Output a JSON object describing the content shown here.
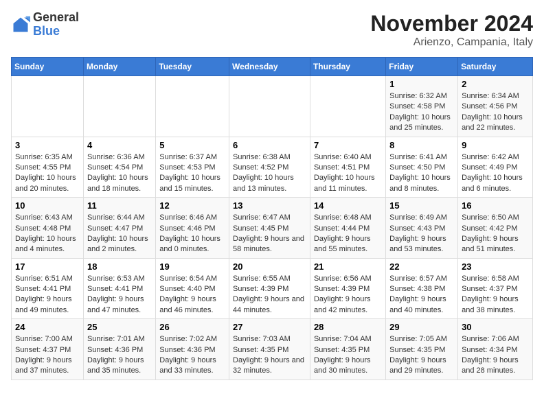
{
  "header": {
    "logo_general": "General",
    "logo_blue": "Blue",
    "month_title": "November 2024",
    "location": "Arienzo, Campania, Italy"
  },
  "days_of_week": [
    "Sunday",
    "Monday",
    "Tuesday",
    "Wednesday",
    "Thursday",
    "Friday",
    "Saturday"
  ],
  "weeks": [
    {
      "days": [
        {
          "number": "",
          "info": ""
        },
        {
          "number": "",
          "info": ""
        },
        {
          "number": "",
          "info": ""
        },
        {
          "number": "",
          "info": ""
        },
        {
          "number": "",
          "info": ""
        },
        {
          "number": "1",
          "info": "Sunrise: 6:32 AM\nSunset: 4:58 PM\nDaylight: 10 hours and 25 minutes."
        },
        {
          "number": "2",
          "info": "Sunrise: 6:34 AM\nSunset: 4:56 PM\nDaylight: 10 hours and 22 minutes."
        }
      ]
    },
    {
      "days": [
        {
          "number": "3",
          "info": "Sunrise: 6:35 AM\nSunset: 4:55 PM\nDaylight: 10 hours and 20 minutes."
        },
        {
          "number": "4",
          "info": "Sunrise: 6:36 AM\nSunset: 4:54 PM\nDaylight: 10 hours and 18 minutes."
        },
        {
          "number": "5",
          "info": "Sunrise: 6:37 AM\nSunset: 4:53 PM\nDaylight: 10 hours and 15 minutes."
        },
        {
          "number": "6",
          "info": "Sunrise: 6:38 AM\nSunset: 4:52 PM\nDaylight: 10 hours and 13 minutes."
        },
        {
          "number": "7",
          "info": "Sunrise: 6:40 AM\nSunset: 4:51 PM\nDaylight: 10 hours and 11 minutes."
        },
        {
          "number": "8",
          "info": "Sunrise: 6:41 AM\nSunset: 4:50 PM\nDaylight: 10 hours and 8 minutes."
        },
        {
          "number": "9",
          "info": "Sunrise: 6:42 AM\nSunset: 4:49 PM\nDaylight: 10 hours and 6 minutes."
        }
      ]
    },
    {
      "days": [
        {
          "number": "10",
          "info": "Sunrise: 6:43 AM\nSunset: 4:48 PM\nDaylight: 10 hours and 4 minutes."
        },
        {
          "number": "11",
          "info": "Sunrise: 6:44 AM\nSunset: 4:47 PM\nDaylight: 10 hours and 2 minutes."
        },
        {
          "number": "12",
          "info": "Sunrise: 6:46 AM\nSunset: 4:46 PM\nDaylight: 10 hours and 0 minutes."
        },
        {
          "number": "13",
          "info": "Sunrise: 6:47 AM\nSunset: 4:45 PM\nDaylight: 9 hours and 58 minutes."
        },
        {
          "number": "14",
          "info": "Sunrise: 6:48 AM\nSunset: 4:44 PM\nDaylight: 9 hours and 55 minutes."
        },
        {
          "number": "15",
          "info": "Sunrise: 6:49 AM\nSunset: 4:43 PM\nDaylight: 9 hours and 53 minutes."
        },
        {
          "number": "16",
          "info": "Sunrise: 6:50 AM\nSunset: 4:42 PM\nDaylight: 9 hours and 51 minutes."
        }
      ]
    },
    {
      "days": [
        {
          "number": "17",
          "info": "Sunrise: 6:51 AM\nSunset: 4:41 PM\nDaylight: 9 hours and 49 minutes."
        },
        {
          "number": "18",
          "info": "Sunrise: 6:53 AM\nSunset: 4:41 PM\nDaylight: 9 hours and 47 minutes."
        },
        {
          "number": "19",
          "info": "Sunrise: 6:54 AM\nSunset: 4:40 PM\nDaylight: 9 hours and 46 minutes."
        },
        {
          "number": "20",
          "info": "Sunrise: 6:55 AM\nSunset: 4:39 PM\nDaylight: 9 hours and 44 minutes."
        },
        {
          "number": "21",
          "info": "Sunrise: 6:56 AM\nSunset: 4:39 PM\nDaylight: 9 hours and 42 minutes."
        },
        {
          "number": "22",
          "info": "Sunrise: 6:57 AM\nSunset: 4:38 PM\nDaylight: 9 hours and 40 minutes."
        },
        {
          "number": "23",
          "info": "Sunrise: 6:58 AM\nSunset: 4:37 PM\nDaylight: 9 hours and 38 minutes."
        }
      ]
    },
    {
      "days": [
        {
          "number": "24",
          "info": "Sunrise: 7:00 AM\nSunset: 4:37 PM\nDaylight: 9 hours and 37 minutes."
        },
        {
          "number": "25",
          "info": "Sunrise: 7:01 AM\nSunset: 4:36 PM\nDaylight: 9 hours and 35 minutes."
        },
        {
          "number": "26",
          "info": "Sunrise: 7:02 AM\nSunset: 4:36 PM\nDaylight: 9 hours and 33 minutes."
        },
        {
          "number": "27",
          "info": "Sunrise: 7:03 AM\nSunset: 4:35 PM\nDaylight: 9 hours and 32 minutes."
        },
        {
          "number": "28",
          "info": "Sunrise: 7:04 AM\nSunset: 4:35 PM\nDaylight: 9 hours and 30 minutes."
        },
        {
          "number": "29",
          "info": "Sunrise: 7:05 AM\nSunset: 4:35 PM\nDaylight: 9 hours and 29 minutes."
        },
        {
          "number": "30",
          "info": "Sunrise: 7:06 AM\nSunset: 4:34 PM\nDaylight: 9 hours and 28 minutes."
        }
      ]
    }
  ]
}
